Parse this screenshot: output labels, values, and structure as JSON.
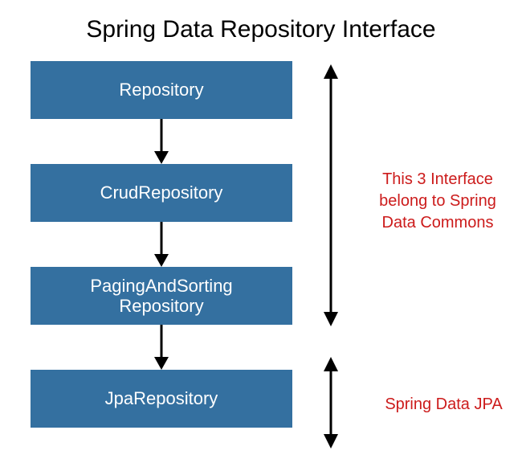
{
  "title": "Spring Data Repository Interface",
  "boxes": {
    "b0": "Repository",
    "b1": "CrudRepository",
    "b2_line1": "PagingAndSorting",
    "b2_line2": "Repository",
    "b3": "JpaRepository"
  },
  "annotations": {
    "commons": "This 3 Interface belong to Spring Data Commons",
    "jpa": "Spring Data JPA"
  },
  "colors": {
    "box_bg": "#3470a0",
    "annotation_text": "#cc1b1b"
  }
}
